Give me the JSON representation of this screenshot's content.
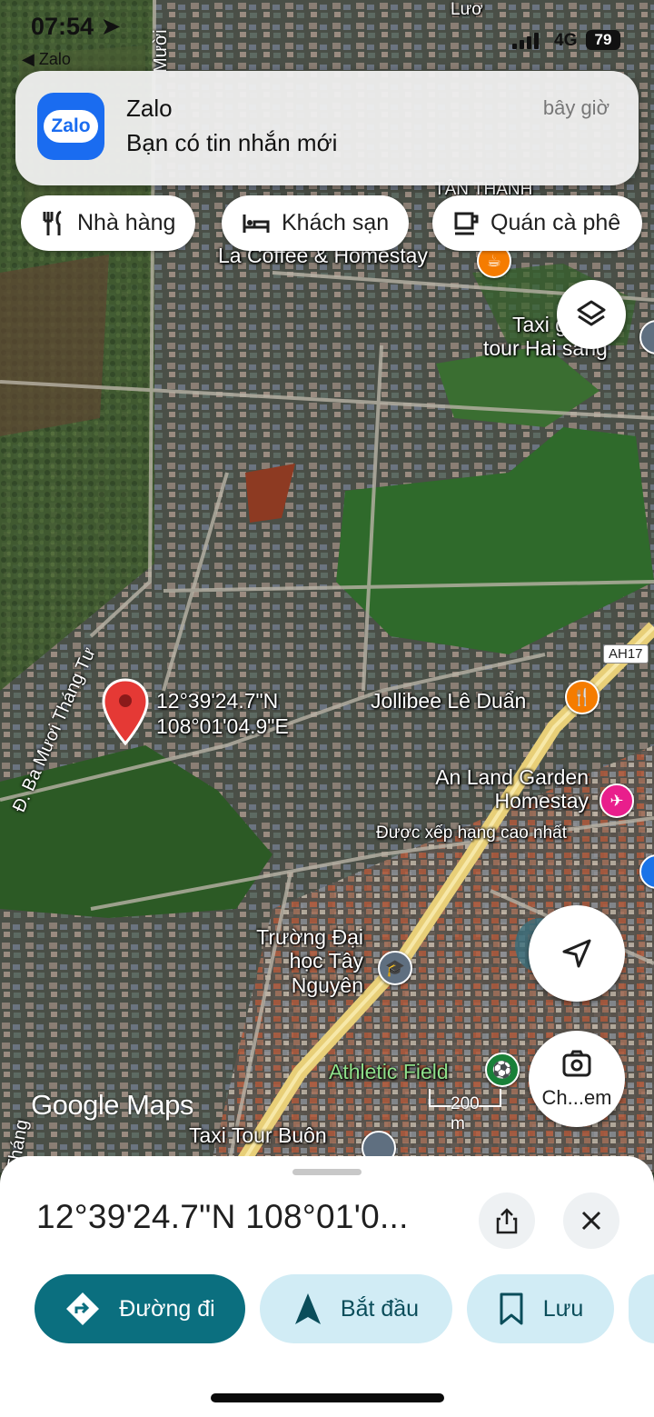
{
  "status_bar": {
    "time": "07:54",
    "back_label": "◀ Zalo",
    "network": "4G",
    "battery": "79"
  },
  "notification": {
    "app_name": "Zalo",
    "icon_text": "Zalo",
    "message": "Bạn có tin nhắn mới",
    "time": "bây giờ"
  },
  "chips": [
    {
      "label": "Nhà hàng",
      "icon": "restaurant-icon"
    },
    {
      "label": "Khách sạn",
      "icon": "hotel-icon"
    },
    {
      "label": "Quán cà phê",
      "icon": "coffee-icon"
    }
  ],
  "map": {
    "place_labels": [
      "La Coffee & Homestay",
      "Taxi giá rẻ\ntour Hai sang",
      "Jollibee Lê Duẩn",
      "An Land Garden\nHomestay",
      "Được xếp hạng cao nhất",
      "Trường Đại\nhọc Tây\nNguyên",
      "Athletic Field",
      "Taxi Tour Buôn",
      "TÂN THÀNH",
      "Lươ"
    ],
    "road_labels": [
      "Đ. Ba Mươi Tháng Tư",
      "Mười",
      "Tháng"
    ],
    "highway_shield": "AH17",
    "pin_coords": "12°39'24.7\"N\n108°01'04.9\"E",
    "scale_text": "200 m",
    "google_logo": "Google Maps",
    "camera_label": "Ch...em"
  },
  "bottom_sheet": {
    "title": "12°39'24.7\"N 108°01'0...",
    "actions": [
      {
        "label": "Đường đi",
        "icon": "directions-icon"
      },
      {
        "label": "Bắt đầu",
        "icon": "navigation-arrow-icon"
      },
      {
        "label": "Lưu",
        "icon": "bookmark-icon"
      }
    ]
  },
  "colors": {
    "primary": "#0b6f7f",
    "secondary": "#d1ecf5",
    "pin": "#e53935",
    "poi_orange": "#f57c00",
    "poi_pink": "#e91e8c",
    "poi_green": "#188038",
    "poi_blue": "#1a73e8"
  }
}
